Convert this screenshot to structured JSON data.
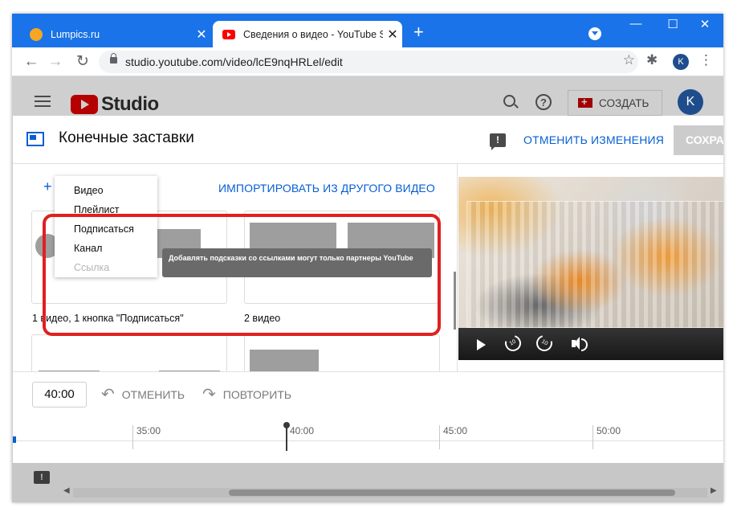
{
  "browser": {
    "tabs": [
      {
        "title": "Lumpics.ru",
        "favicon_color": "#f5a623"
      },
      {
        "title": "Сведения о видео - YouTube Studio"
      }
    ],
    "new_tab_label": "+",
    "close_glyph": "✕",
    "window_controls": {
      "minimize": "—",
      "maximize": "☐",
      "close": "✕"
    },
    "url": "studio.youtube.com/video/lcE9nqHRLel/edit",
    "profile_initial": "K",
    "accent": "#1a73e8"
  },
  "studio": {
    "logo_text": "Studio",
    "create_label": "СОЗДАТЬ",
    "avatar_initial": "K"
  },
  "modal": {
    "title": "Конечные заставки",
    "discard_label": "ОТМЕНИТЬ ИЗМЕНЕНИЯ",
    "save_label": "СОХРАНИТЬ",
    "import_label": "ИМПОРТИРОВАТЬ ИЗ ДРУГОГО ВИДЕО",
    "add_menu": {
      "items": [
        {
          "label": "Видео",
          "disabled": false
        },
        {
          "label": "Плейлист",
          "disabled": false
        },
        {
          "label": "Подписаться",
          "disabled": false
        },
        {
          "label": "Канал",
          "disabled": false
        },
        {
          "label": "Ссылка",
          "disabled": true
        }
      ],
      "tooltip": "Добавлять подсказки со ссылками могут только партнеры YouTube"
    },
    "templates": [
      {
        "label": "1 видео, 1 кнопка \"Подписаться\""
      },
      {
        "label": "2 видео"
      },
      {
        "label": ""
      },
      {
        "label": ""
      }
    ],
    "highlight_color": "#e02020",
    "link_color": "#065fd4"
  },
  "timeline": {
    "current_time": "40:00",
    "undo_label": "ОТМЕНИТЬ",
    "redo_label": "ПОВТОРИТЬ",
    "ticks": [
      "35:00",
      "40:00",
      "45:00",
      "50:00"
    ]
  }
}
